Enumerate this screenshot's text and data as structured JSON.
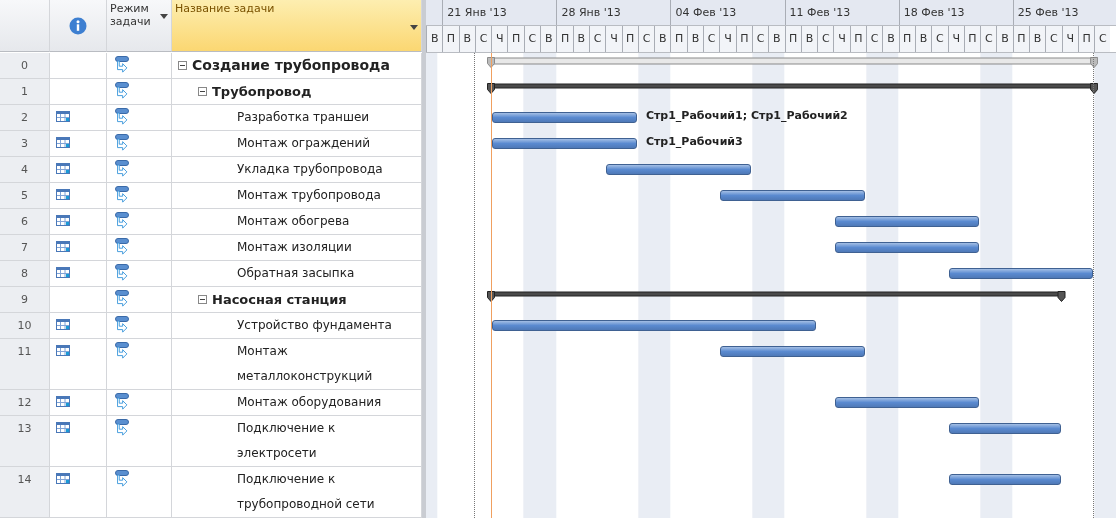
{
  "table": {
    "columns": [
      {
        "kind": "info"
      },
      {
        "kind": "mode",
        "label": "Режим задачи",
        "selected": false
      },
      {
        "kind": "name",
        "label": "Название задачи",
        "selected": true
      }
    ]
  },
  "timescale": {
    "weeks": [
      "21 Янв '13",
      "28 Янв '13",
      "04 Фев '13",
      "11 Фев '13",
      "18 Фев '13",
      "25 Фев '13"
    ],
    "days": [
      "В",
      "П",
      "В",
      "С",
      "Ч",
      "П",
      "С",
      "В",
      "П",
      "В",
      "С",
      "Ч",
      "П",
      "С",
      "В",
      "П",
      "В",
      "С",
      "Ч",
      "П",
      "С",
      "В",
      "П",
      "В",
      "С",
      "Ч",
      "П",
      "С",
      "В",
      "П",
      "В",
      "С",
      "Ч",
      "П",
      "С",
      "В",
      "П",
      "В",
      "С",
      "Ч",
      "П",
      "С"
    ]
  },
  "tasks": [
    {
      "id": "0",
      "kind": "project",
      "name": "Создание трубопровода",
      "expanded": true,
      "auto_scheduled": true,
      "calendar": false,
      "children": [
        {
          "id": "1",
          "kind": "summary",
          "name": "Трубопровод",
          "expanded": true,
          "auto_scheduled": true,
          "calendar": false,
          "children": [
            {
              "id": "2",
              "kind": "task",
              "calendar": true,
              "name": "Разработка траншеи",
              "auto_scheduled": true,
              "resources": "Стр1_Рабочий1; Стр1_Рабочий2"
            },
            {
              "id": "3",
              "kind": "task",
              "calendar": true,
              "name": "Монтаж ограждений",
              "auto_scheduled": true,
              "resources": "Стр1_Рабочий3"
            },
            {
              "id": "4",
              "kind": "task",
              "calendar": true,
              "name": "Укладка трубопровода",
              "auto_scheduled": true
            },
            {
              "id": "5",
              "kind": "task",
              "calendar": true,
              "name": "Монтаж трубопровода",
              "auto_scheduled": true
            },
            {
              "id": "6",
              "kind": "task",
              "calendar": true,
              "name": "Монтаж обогрева",
              "auto_scheduled": true
            },
            {
              "id": "7",
              "kind": "task",
              "calendar": true,
              "name": "Монтаж изоляции",
              "auto_scheduled": true
            },
            {
              "id": "8",
              "kind": "task",
              "calendar": true,
              "name": "Обратная засыпка",
              "auto_scheduled": true
            }
          ]
        },
        {
          "id": "9",
          "kind": "summary",
          "name": "Насосная станция",
          "expanded": true,
          "auto_scheduled": true,
          "calendar": false,
          "children": [
            {
              "id": "10",
              "kind": "task",
              "calendar": true,
              "name": "Устройство фундамента",
              "auto_scheduled": true
            },
            {
              "id": "11",
              "kind": "task",
              "calendar": true,
              "name": "Монтаж металлоконструкций",
              "auto_scheduled": true
            },
            {
              "id": "12",
              "kind": "task",
              "calendar": true,
              "name": "Монтаж оборудования",
              "auto_scheduled": true
            },
            {
              "id": "13",
              "kind": "task",
              "calendar": true,
              "name": "Подключение к электросети",
              "auto_scheduled": true
            },
            {
              "id": "14",
              "kind": "task",
              "calendar": true,
              "name": "Подключение к трубопроводной сети",
              "auto_scheduled": true
            }
          ]
        }
      ]
    }
  ]
}
